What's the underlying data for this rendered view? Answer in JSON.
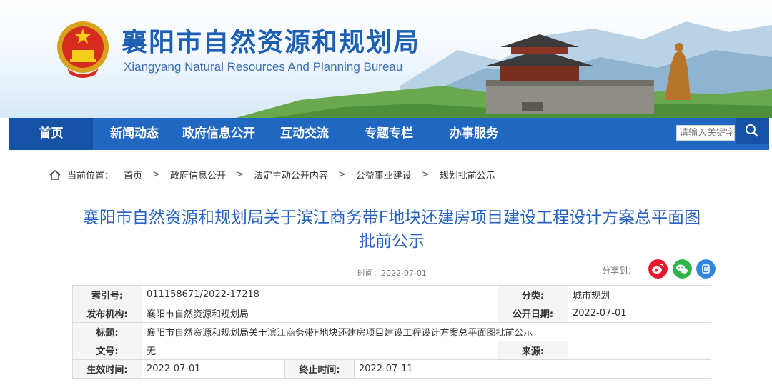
{
  "header": {
    "title": "襄阳市自然资源和规划局",
    "subtitle": "Xiangyang Natural Resources And Planning Bureau",
    "emblem_icon": "national-emblem-icon"
  },
  "nav": {
    "items": [
      {
        "label": "首页"
      },
      {
        "label": "新闻动态"
      },
      {
        "label": "政府信息公开"
      },
      {
        "label": "互动交流"
      },
      {
        "label": "专题专栏"
      },
      {
        "label": "办事服务"
      }
    ],
    "search": {
      "placeholder": "请输入关键字",
      "icon": "search-icon"
    },
    "color": "#1f67c1"
  },
  "breadcrumb": {
    "prefix": "当前位置：",
    "separator": ">",
    "items": [
      "首页",
      "政府信息公开",
      "法定主动公开内容",
      "公益事业建设",
      "规划批前公示"
    ]
  },
  "article": {
    "title_line1": "襄阳市自然资源和规划局关于滨江商务带F地块还建房项目建设工程设计方案总平面图",
    "title_line2": "批前公示",
    "time": "时间：2022-07-01",
    "share_label": "分享到：",
    "share_icons": [
      "weibo-icon",
      "wechat-icon",
      "copy-link-icon"
    ]
  },
  "meta": {
    "index_label": "索引号:",
    "index_value": "011158671/2022-17218",
    "category_label": "分类:",
    "category_value": "城市规划",
    "publisher_label": "发布机构:",
    "publisher_value": "襄阳市自然资源和规划局",
    "pubdate_label": "公开日期:",
    "pubdate_value": "2022-07-01",
    "subject_label": "标题:",
    "subject_value": "襄阳市自然资源和规划局关于滨江商务带F地块还建房项目建设工程设计方案总平面图批前公示",
    "docno_label": "文号:",
    "docno_value": "无",
    "source_label": "来源:",
    "source_value": "",
    "effective_label": "生效时间:",
    "effective_value": "2022-07-01",
    "expiry_label": "终止时间:",
    "expiry_value": "2022-07-11"
  }
}
